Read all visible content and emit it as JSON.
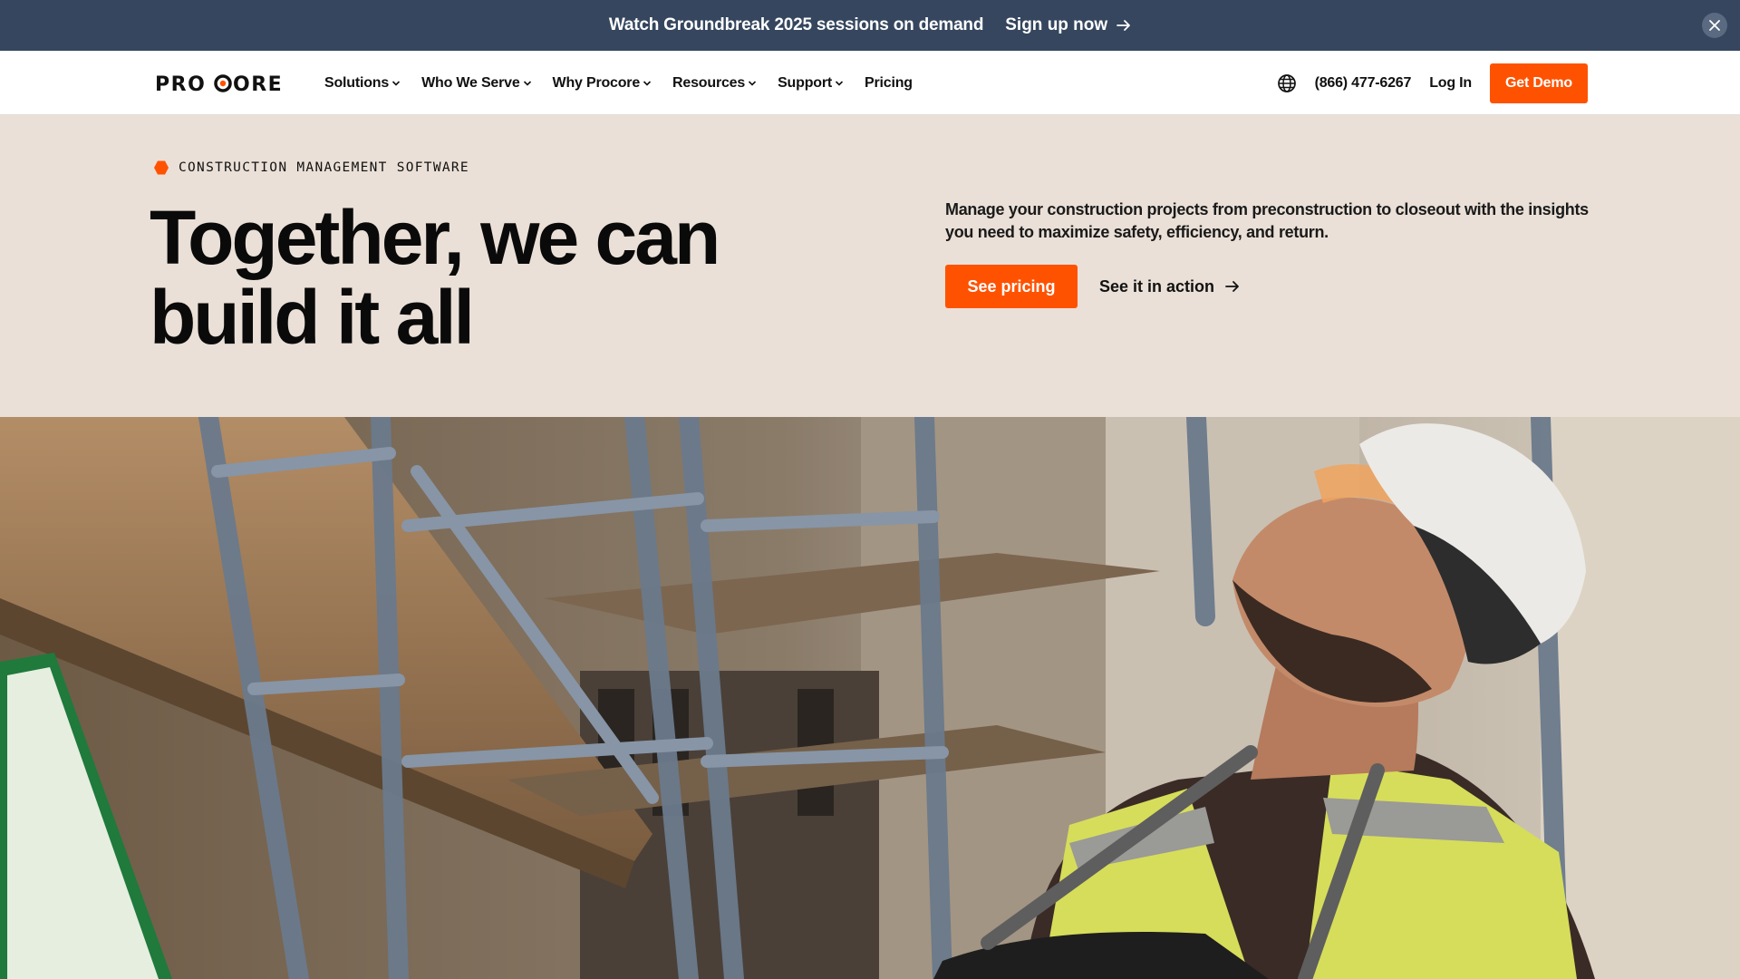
{
  "banner": {
    "message": "Watch Groundbreak 2025 sessions on demand",
    "cta_label": "Sign up now",
    "icons": [
      "arrow-right-icon",
      "close-icon"
    ]
  },
  "nav": {
    "logo_text": "PROCORE",
    "items": [
      {
        "label": "Solutions",
        "has_dropdown": true
      },
      {
        "label": "Who We Serve",
        "has_dropdown": true
      },
      {
        "label": "Why Procore",
        "has_dropdown": true
      },
      {
        "label": "Resources",
        "has_dropdown": true
      },
      {
        "label": "Support",
        "has_dropdown": true
      },
      {
        "label": "Pricing",
        "has_dropdown": false
      }
    ],
    "phone": "(866) 477-6267",
    "login_label": "Log In",
    "demo_label": "Get Demo"
  },
  "hero": {
    "eyebrow": "CONSTRUCTION MANAGEMENT SOFTWARE",
    "headline_line1": "Together, we can",
    "headline_line2": "build it all",
    "description": "Manage your construction projects from preconstruction to closeout with the insights you need to maximize safety, efficiency, and return.",
    "primary_cta": "See pricing",
    "secondary_cta": "See it in action"
  },
  "colors": {
    "brand_orange": "#ff5200",
    "banner_bg": "#35465e",
    "hero_bg": "#eae0d7"
  }
}
